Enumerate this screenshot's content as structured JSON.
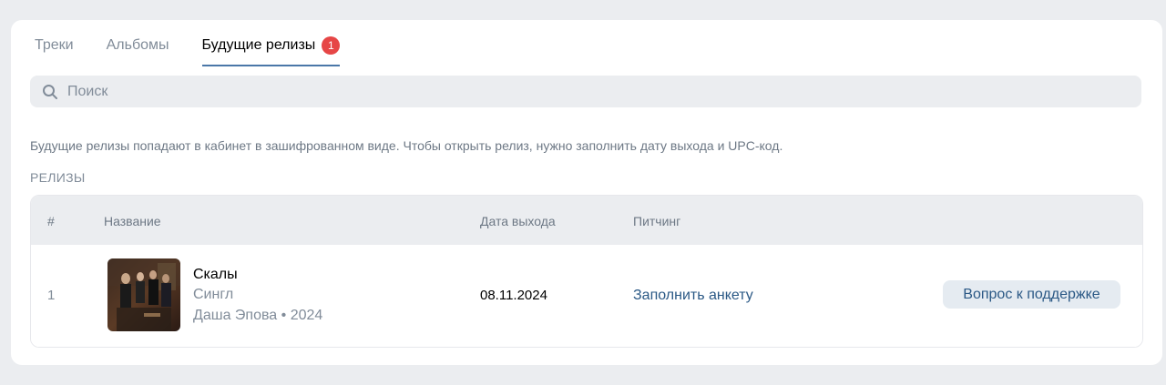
{
  "tabs": [
    {
      "label": "Треки"
    },
    {
      "label": "Альбомы"
    },
    {
      "label": "Будущие релизы",
      "badge": "1"
    }
  ],
  "search": {
    "placeholder": "Поиск",
    "value": ""
  },
  "info_text": "Будущие релизы попадают в кабинет в зашифрованном виде. Чтобы открыть релиз, нужно заполнить дату выхода и UPC-код.",
  "section_title": "РЕЛИЗЫ",
  "table": {
    "headers": {
      "num": "#",
      "name": "Название",
      "date": "Дата выхода",
      "pitching": "Питчинг"
    },
    "rows": [
      {
        "num": "1",
        "title": "Скалы",
        "type": "Сингл",
        "artist_year": "Даша Эпова • 2024",
        "date": "08.11.2024",
        "pitch_link": "Заполнить анкету",
        "support_button": "Вопрос к поддержке"
      }
    ]
  },
  "colors": {
    "accent": "#4a77a8",
    "badge": "#e64646",
    "link": "#2a5885"
  }
}
